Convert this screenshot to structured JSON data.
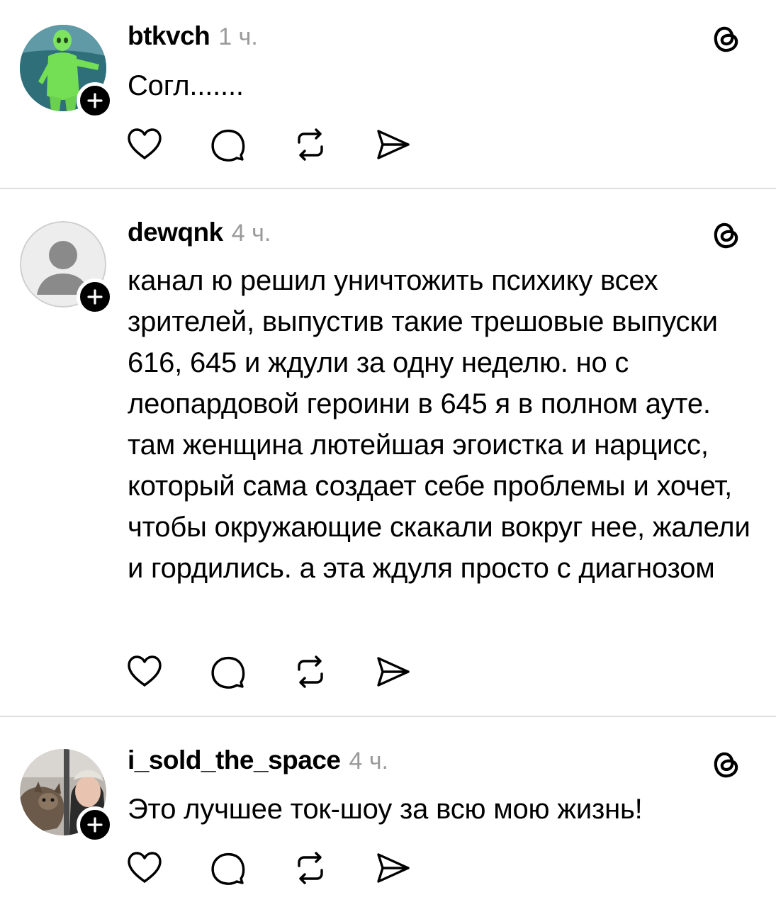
{
  "posts": [
    {
      "username": "btkvch",
      "time": "1 ч.",
      "text": "Согл.......",
      "avatar": "green-alien-costume-photo"
    },
    {
      "username": "dewqnk",
      "time": "4 ч.",
      "text": "канал ю решил уничтожить психику всех зрителей, выпустив такие трешовые выпуски 616, 645 и ждули за одну неделю. но с леопардовой героини в 645 я в полном ауте. там женщина лютейшая эгоистка и нарцисс, который сама создает себе проблемы и хочет, чтобы окружающие скакали вокруг нее, жалели и гордились. а эта ждуля просто с диагнозом",
      "avatar": "default-user-icon"
    },
    {
      "username": "i_sold_the_space",
      "time": "4 ч.",
      "text": "Это лучшее ток-шоу за всю мою жизнь!",
      "avatar": "person-with-dog-photo"
    }
  ],
  "actions": [
    "heart-icon",
    "reply-bubble-icon",
    "repost-icon",
    "send-icon"
  ],
  "colors": {
    "text": "#000000",
    "muted": "#9a9a9a",
    "divider": "#dedede",
    "badge": "#000000"
  }
}
